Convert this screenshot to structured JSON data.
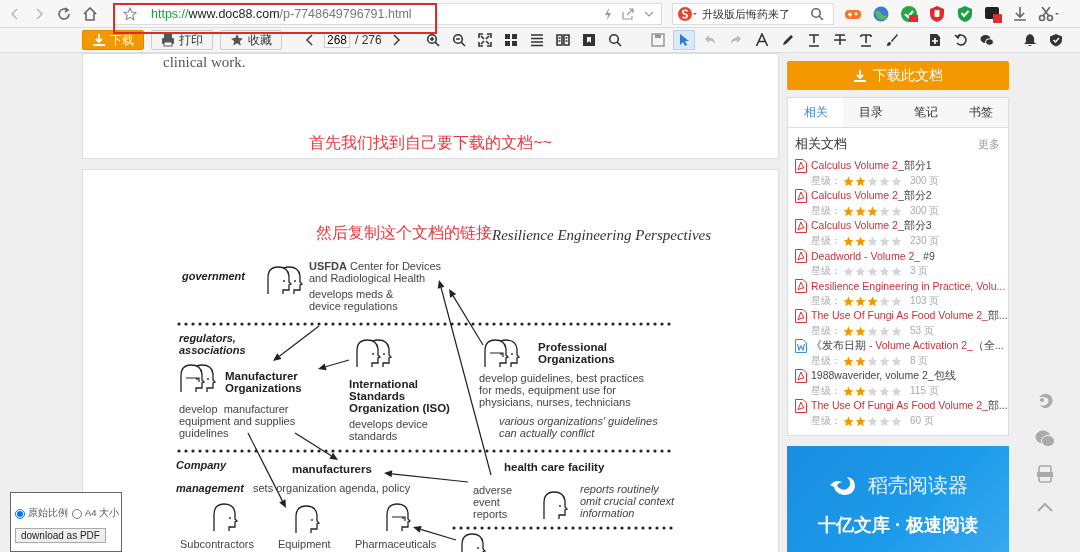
{
  "browser": {
    "url": {
      "scheme": "https://",
      "host": "www.doc88.com",
      "path": "/p-7748649796791.html"
    },
    "search": {
      "placeholder": "升级版后悔药来了"
    }
  },
  "toolbar": {
    "buttons": [
      {
        "label": "下载",
        "kind": "primary"
      },
      {
        "label": "打印",
        "kind": "print"
      },
      {
        "label": "收藏",
        "kind": "star"
      }
    ],
    "page_field": {
      "value": "268",
      "total": "/ 276"
    },
    "tool_groups": [
      [
        {
          "kind": "zoomin",
          "selected": false
        },
        {
          "kind": "zoomout",
          "selected": false
        },
        {
          "kind": "fit",
          "selected": false
        },
        {
          "kind": "grid",
          "selected": false
        },
        {
          "kind": "list",
          "selected": false
        },
        {
          "kind": "book",
          "selected": false
        },
        {
          "kind": "clip",
          "selected": false
        },
        {
          "kind": "search",
          "selected": false
        }
      ],
      [
        {
          "kind": "save",
          "selected": false
        },
        {
          "kind": "cursor",
          "selected": true
        },
        {
          "kind": "undo",
          "selected": false
        },
        {
          "kind": "redo",
          "selected": false
        },
        {
          "kind": "text",
          "selected": false
        },
        {
          "kind": "pen",
          "selected": false
        },
        {
          "kind": "underline",
          "selected": false
        },
        {
          "kind": "strike",
          "selected": false
        },
        {
          "kind": "title",
          "selected": false
        },
        {
          "kind": "brush",
          "selected": false
        }
      ],
      [
        {
          "kind": "add",
          "selected": false
        },
        {
          "kind": "rotate",
          "selected": false
        },
        {
          "kind": "chat",
          "selected": false
        }
      ],
      [
        {
          "kind": "bell",
          "selected": false
        },
        {
          "kind": "shield",
          "selected": false
        }
      ]
    ]
  },
  "document": {
    "page_1": {
      "text": "clinical work.",
      "note": "首先我们找到自己要下载的文档~~"
    },
    "page_2": {
      "note": "然后复制这个文档的链接",
      "header": "Resilience Engineering Perspectives",
      "labels": [
        {
          "kind": "tier",
          "text": "government"
        },
        {
          "kind": "desc",
          "text": "**USFDA** Center for Devices\nand Radiological Health"
        },
        {
          "kind": "desc",
          "text": "develops meds &\ndevice regulations"
        },
        {
          "kind": "tier",
          "text": "regulators,\nassociations"
        },
        {
          "kind": "title",
          "text": "Manufacturer\nOrganizations"
        },
        {
          "kind": "desc",
          "text": "develop  manufacturer\nequipment and supplies\nguidelines"
        },
        {
          "kind": "title",
          "text": "International\nStandards\nOrganization (ISO)"
        },
        {
          "kind": "desc",
          "text": "develops device\nstandards"
        },
        {
          "kind": "title",
          "text": "Professional\nOrganizations"
        },
        {
          "kind": "desc",
          "text": "develop guidelines, best practices\nfor meds, equipment use for\nphysicians, nurses, technicians"
        },
        {
          "kind": "note",
          "text": "various organizations' guidelines\ncan actually conflict"
        },
        {
          "kind": "tier",
          "text": "Company"
        },
        {
          "kind": "title",
          "text": "manufacturers"
        },
        {
          "kind": "title",
          "text": "health care facility"
        },
        {
          "kind": "tier",
          "text": "management"
        },
        {
          "kind": "desc",
          "text": "sets organization agenda, policy"
        },
        {
          "kind": "desc",
          "text": "adverse\nevent\nreports"
        },
        {
          "kind": "note",
          "text": "reports routinely\nomit crucial context\ninformation"
        },
        {
          "kind": "desc",
          "text": "Subcontractors"
        },
        {
          "kind": "desc",
          "text": "Equipment"
        },
        {
          "kind": "desc",
          "text": "Pharmaceuticals"
        }
      ]
    }
  },
  "sidebar": {
    "download_button": "下载此文档",
    "tabs": [
      {
        "label": "相关",
        "selected": true
      },
      {
        "label": "目录",
        "selected": false
      },
      {
        "label": "笔记",
        "selected": false
      },
      {
        "label": "书签",
        "selected": false
      }
    ],
    "section_title": "相关文档",
    "more_link": "更多",
    "documents": [
      {
        "kind": "pdf",
        "title": [
          {
            "text": "Calculus Volume 2",
            "highlight": true
          },
          {
            "text": "_部分1",
            "highlight": false
          }
        ],
        "rating_label": "星级：",
        "stars": 2,
        "pages": "300 页"
      },
      {
        "kind": "pdf",
        "title": [
          {
            "text": "Calculus Volume 2",
            "highlight": true
          },
          {
            "text": "_部分2",
            "highlight": false
          }
        ],
        "rating_label": "星级：",
        "stars": 3,
        "pages": "300 页"
      },
      {
        "kind": "pdf",
        "title": [
          {
            "text": "Calculus Volume 2",
            "highlight": true
          },
          {
            "text": "_部分3",
            "highlight": false
          }
        ],
        "rating_label": "星级：",
        "stars": 2,
        "pages": "230 页"
      },
      {
        "kind": "pdf",
        "title": [
          {
            "text": "Deadworld - Volume 2_",
            "highlight": true
          },
          {
            "text": " #9",
            "highlight": false
          }
        ],
        "rating_label": "星级：",
        "stars": 0,
        "pages": "3 页"
      },
      {
        "kind": "pdf",
        "title": [
          {
            "text": "Resilience Engineering in Practice, Volu...",
            "highlight": true
          }
        ],
        "rating_label": "星级：",
        "stars": 3,
        "pages": "103 页"
      },
      {
        "kind": "pdf",
        "title": [
          {
            "text": "The Use Of Fungi As Food Volume 2_",
            "highlight": true
          },
          {
            "text": "部...",
            "highlight": false
          }
        ],
        "rating_label": "星级：",
        "stars": 2,
        "pages": "53 页"
      },
      {
        "kind": "word",
        "title": [
          {
            "text": "《发布日期 ",
            "highlight": false
          },
          {
            "text": "- Volume Activation 2_",
            "highlight": true
          },
          {
            "text": "（全...",
            "highlight": false
          }
        ],
        "rating_label": "星级：",
        "stars": 2,
        "pages": "8 页"
      },
      {
        "kind": "pdf",
        "title": [
          {
            "text": "1988waverider, volume 2_包线",
            "highlight": false
          }
        ],
        "rating_label": "星级：",
        "stars": 2,
        "pages": "115 页"
      },
      {
        "kind": "pdf",
        "title": [
          {
            "text": "The Use Of Fungi As Food Volume 2_",
            "highlight": true
          },
          {
            "text": "部...",
            "highlight": false
          }
        ],
        "rating_label": "星级：",
        "stars": 2,
        "pages": "60 页"
      }
    ],
    "ad": {
      "title": "稻壳阅读器",
      "slogan": "十亿文库 · 极速阅读"
    }
  },
  "pdf_panel": {
    "options": [
      {
        "label": "原始比例",
        "selected": true
      },
      {
        "label": "A4 大小",
        "selected": false
      }
    ],
    "button": "download as PDF"
  }
}
